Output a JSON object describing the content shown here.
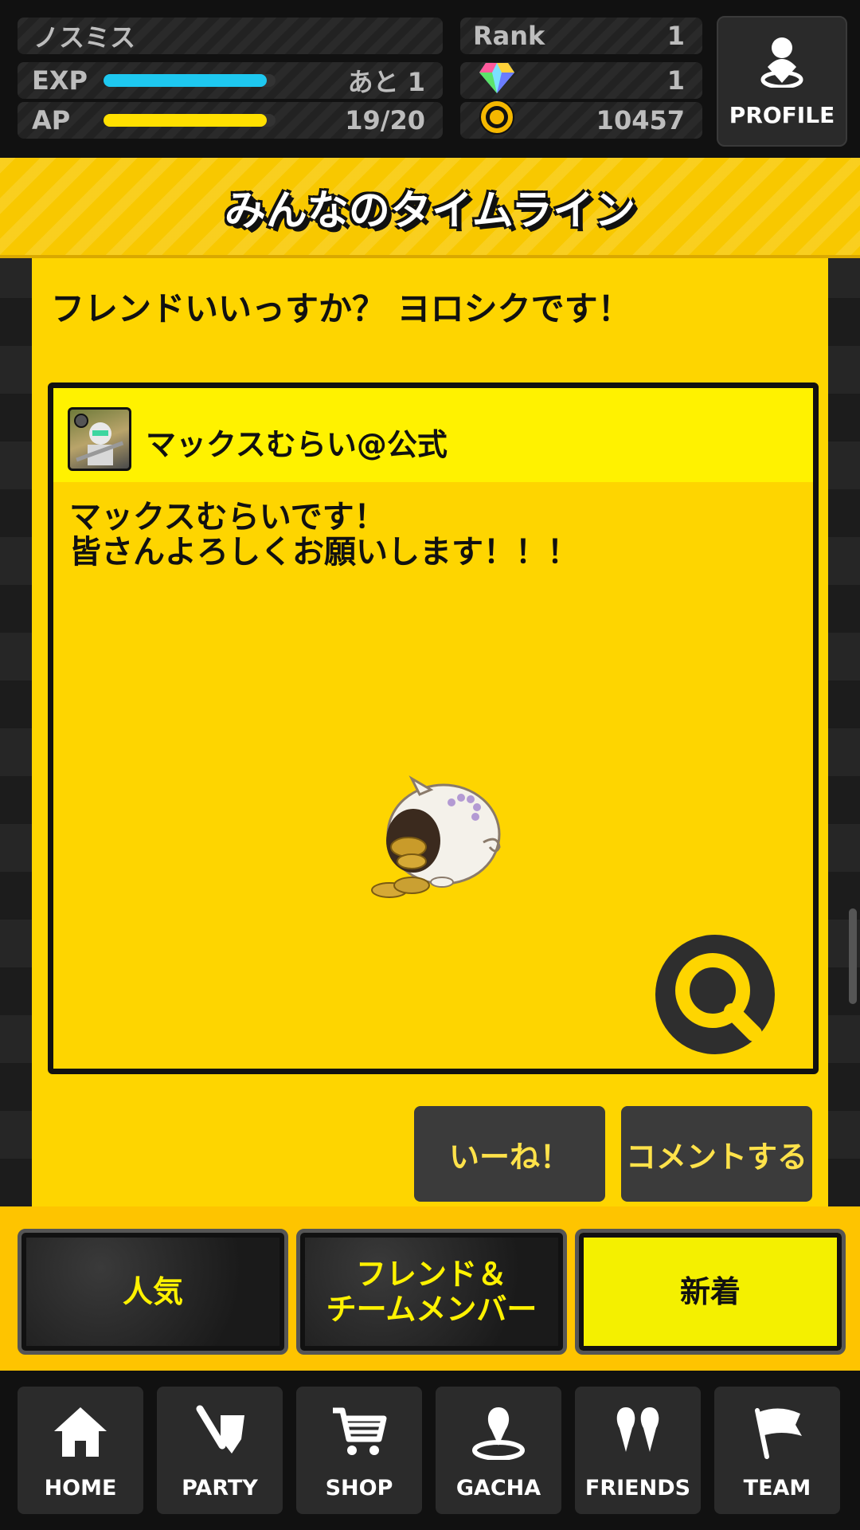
{
  "header": {
    "player_name": "ノスミス",
    "exp_label": "EXP",
    "exp_remaining": "あと 1",
    "exp_fill": 0.95,
    "ap_label": "AP",
    "ap_value": "19/20",
    "ap_fill": 0.95,
    "rank_label": "Rank",
    "rank_value": "1",
    "gem_value": "1",
    "coin_value": "10457",
    "profile_label": "PROFILE",
    "colors": {
      "exp": "#1ec8f0",
      "ap": "#ffe000"
    }
  },
  "banner": {
    "title": "みんなのタイムライン"
  },
  "feed": {
    "prev_post_text": "フレンドいいっすか？ ヨロシクです！",
    "post": {
      "author": "マックスむらい@公式",
      "body": "マックスむらいです！\n皆さんよろしくお願いします！！！",
      "image_icon": "piggy-bank-coins-image",
      "zoom_icon": "magnifier-icon"
    },
    "like_label": "いーね！",
    "comment_label": "コメントする"
  },
  "tabs": [
    {
      "label": "人気",
      "active": false
    },
    {
      "label": "フレンド＆\nチームメンバー",
      "active": false
    },
    {
      "label": "新着",
      "active": true
    }
  ],
  "nav": [
    {
      "label": "HOME",
      "icon": "home-icon"
    },
    {
      "label": "PARTY",
      "icon": "sword-shield-icon"
    },
    {
      "label": "SHOP",
      "icon": "cart-icon"
    },
    {
      "label": "GACHA",
      "icon": "gacha-pin-icon"
    },
    {
      "label": "FRIENDS",
      "icon": "friends-icon"
    },
    {
      "label": "TEAM",
      "icon": "flag-icon"
    }
  ]
}
